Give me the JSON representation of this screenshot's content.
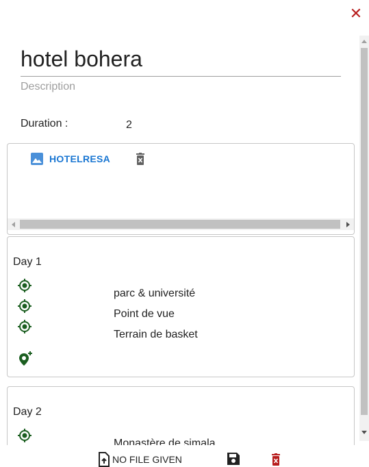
{
  "close": {
    "symbol": "✕"
  },
  "itinerary": {
    "title": "hotel bohera",
    "description_placeholder": "Description",
    "duration_label": "Duration :",
    "duration_value": "2"
  },
  "files": {
    "items": [
      {
        "name": "HOTELRESA"
      }
    ]
  },
  "days": [
    {
      "title": "Day 1",
      "places": [
        "parc & université",
        "Point de vue",
        "Terrain de basket"
      ]
    },
    {
      "title": "Day 2",
      "places": [
        "Monastère de simala"
      ]
    }
  ],
  "footer": {
    "upload_label": "NO FILE GIVEN"
  },
  "colors": {
    "close": "#b71c1c",
    "link": "#1976d2",
    "poi": "#1b5e20",
    "delete": "#b71c1c"
  }
}
